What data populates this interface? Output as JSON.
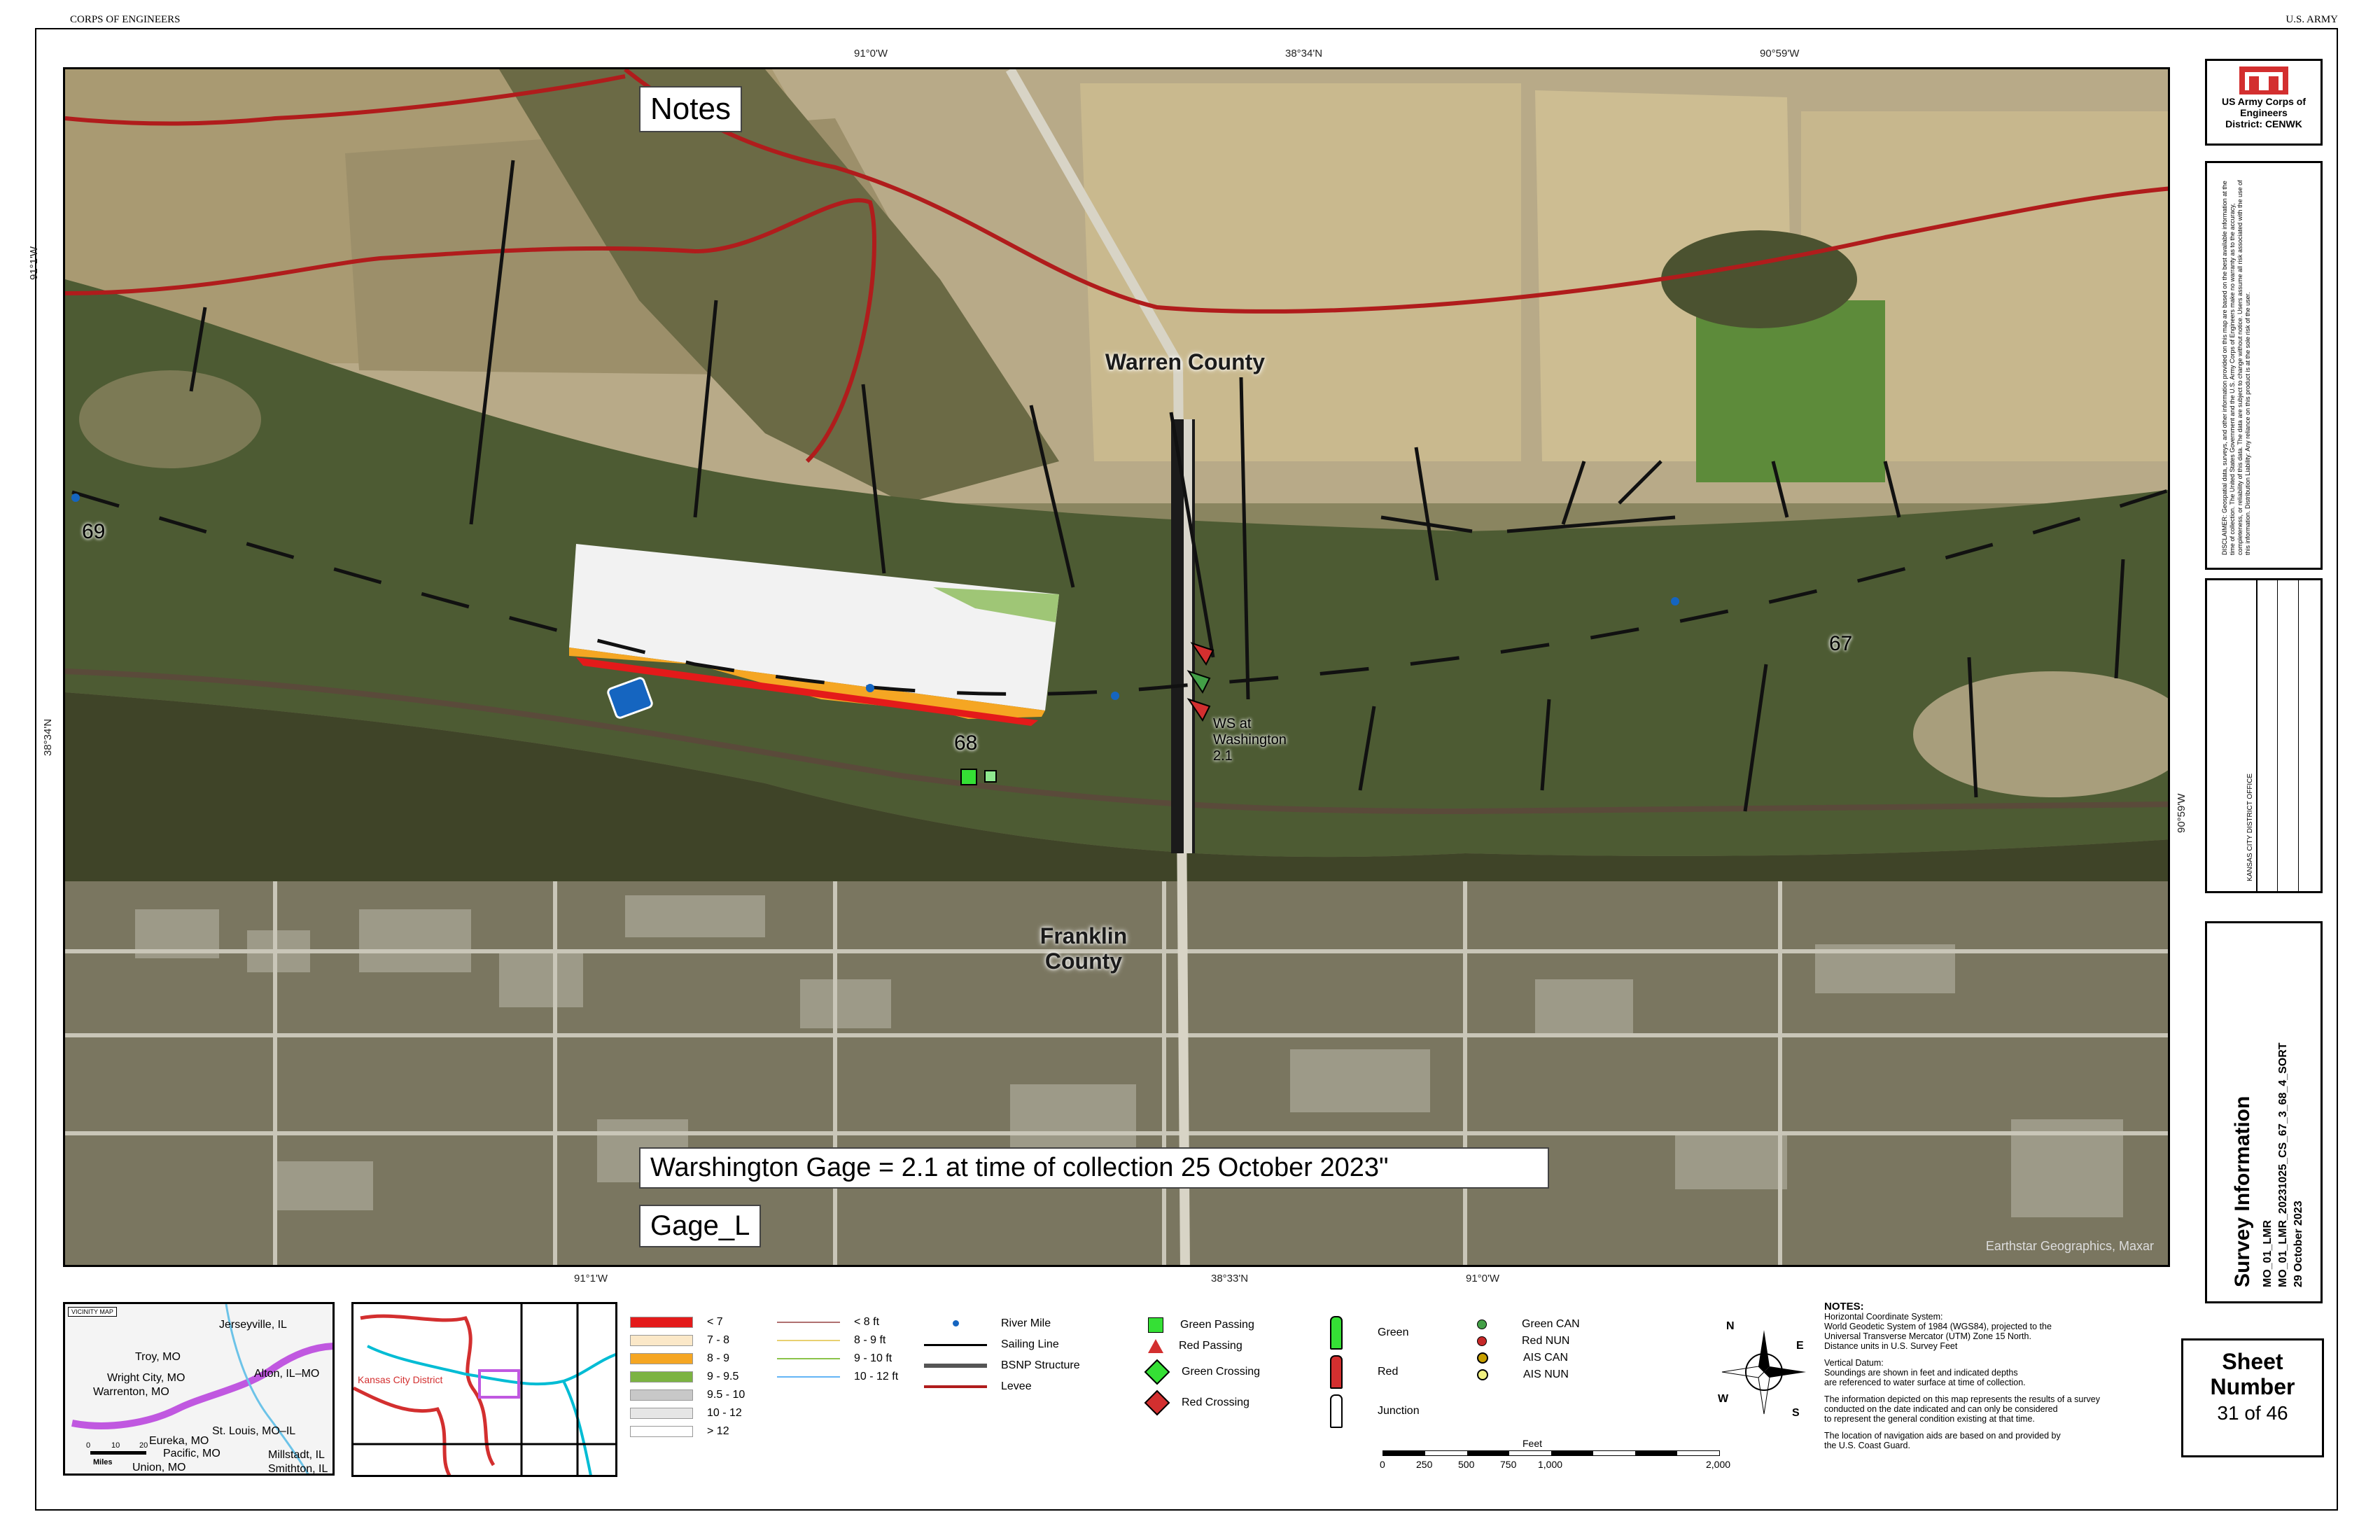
{
  "header": {
    "left": "CORPS OF ENGINEERS",
    "right": "U.S. ARMY"
  },
  "coords": {
    "top": [
      "91°0'W",
      "38°34'N",
      "90°59'W"
    ],
    "bottom": [
      "91°1'W",
      "38°33'N",
      "91°0'W"
    ],
    "left": [
      "91°1'W",
      "38°34'N"
    ],
    "right": [
      "90°59'W"
    ]
  },
  "map": {
    "notes_label": "Notes",
    "gage_text": "Warshington Gage = 2.1 at time of collection 25 October 2023\"",
    "gage_label": "Gage_L",
    "counties": [
      "Warren County",
      "Franklin County"
    ],
    "river_miles": [
      "69",
      "68",
      "67"
    ],
    "ws_label": "WS at Washington 2.1",
    "copyright": "Earthstar Geographics, Maxar"
  },
  "title_block": {
    "org": "US Army Corps of Engineers",
    "district": "District: CENWK",
    "disclaimer": "DISCLAIMER: Geospatial data, surveys, and other information provided on this map are based on the best available information at the time of collection. The United States Government and the U.S. Army Corps of Engineers make no warranty as to the accuracy, completeness, or reliability of this data. The data are subject to change without notice. Users assume all risk associated with the use of this information. Distribution Liability: Any reliance on this product is at the sole risk of the user.",
    "office_label": "KANSAS CITY DISTRICT OFFICE",
    "sheet_label": "Sheet Number",
    "sheet_num": "31 of 46",
    "survey_title": "Survey Information",
    "survey_lines": [
      "MO_01_LMR",
      "MO_01_LMR_20231025_CS_67_3_68_4_SORT",
      "29 October 2023"
    ]
  },
  "vicinity": {
    "title": "VICINITY MAP",
    "places": [
      "Jerseyville, IL",
      "Troy, MO",
      "Wright City, MO",
      "Warrenton, MO",
      "Alton, IL–MO",
      "St. Louis, MO–IL",
      "Eureka, MO",
      "Pacific, MO",
      "Union, MO",
      "Millstadt, IL",
      "Smithton, IL"
    ],
    "scale_ticks": [
      "0",
      "10",
      "20"
    ],
    "scale_unit": "Miles"
  },
  "overview": {
    "label": "Kansas City District"
  },
  "legend": {
    "depth_labels": [
      "< 7",
      "7 - 8",
      "8 - 9",
      "9 - 9.5",
      "9.5 - 10",
      "10 - 12",
      "> 12"
    ],
    "depth_colors": [
      "#e41a1a",
      "#fbe8c8",
      "#f5a623",
      "#7cb342",
      "#c8c8c8",
      "#e6e6e6",
      "#ffffff"
    ],
    "contour_labels": [
      "< 8 ft",
      "8 - 9 ft",
      "9 - 10 ft",
      "10 - 12 ft"
    ],
    "contour_colors": [
      "#b07070",
      "#e8d070",
      "#8bc34a",
      "#64b5f6"
    ],
    "line_labels": [
      "River Mile",
      "Sailing Line",
      "BSNP Structure",
      "Levee"
    ],
    "marker_labels": [
      "Green Passing",
      "Red Passing",
      "Green Crossing",
      "Red Crossing"
    ],
    "buoy_labels": [
      "Green",
      "Red",
      "Junction"
    ],
    "can_labels": [
      "Green CAN",
      "Red NUN",
      "AIS CAN",
      "AIS NUN"
    ],
    "scale_unit": "Feet",
    "scale_ticks": [
      "0",
      "250",
      "500",
      "750",
      "1,000",
      "2,000"
    ]
  },
  "notes": {
    "title": "NOTES:",
    "lines": [
      "Horizontal Coordinate System:",
      "World Geodetic System of 1984 (WGS84), projected to the",
      "Universal Transverse Mercator (UTM) Zone 15 North.",
      "Distance units in U.S. Survey Feet",
      "",
      "Vertical Datum:",
      "Soundings are shown in feet and indicated depths",
      "are referenced to water surface at time of collection.",
      "",
      "The information depicted on this map represents the results of a survey",
      "conducted on the date indicated and can only be considered",
      "to represent the general condition existing at that time.",
      "",
      "The location of navigation aids are based on and provided by",
      "the U.S. Coast Guard."
    ]
  },
  "compass": {
    "n": "N",
    "s": "S",
    "e": "E",
    "w": "W"
  }
}
